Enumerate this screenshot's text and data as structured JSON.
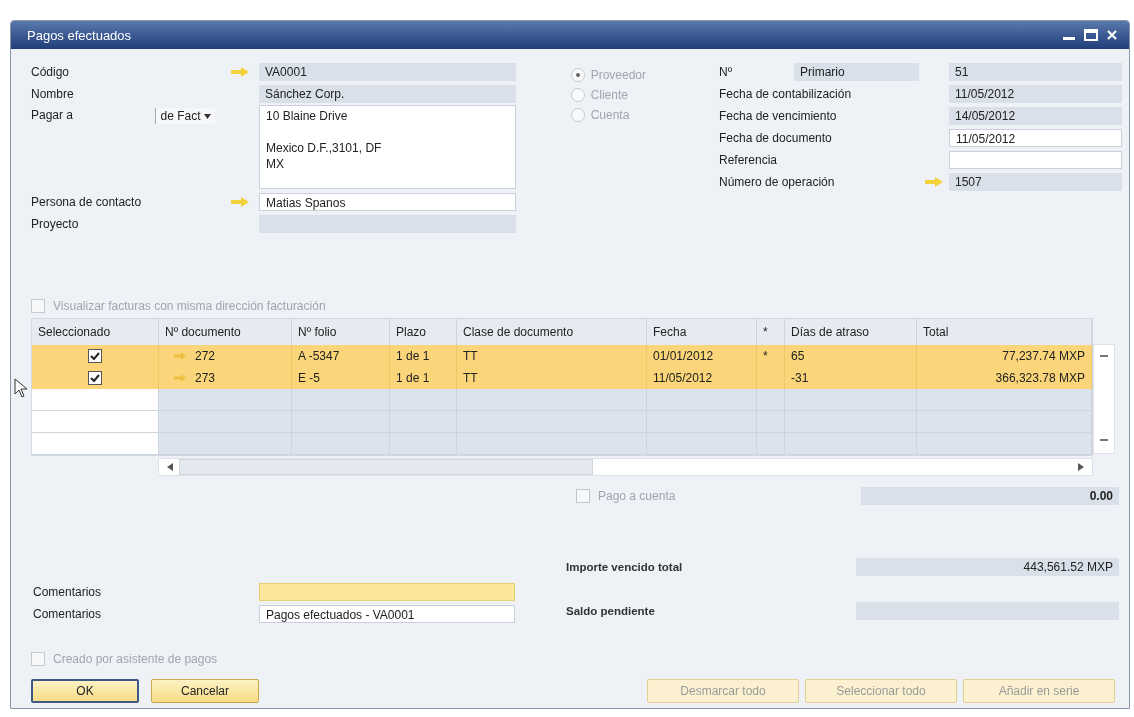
{
  "window": {
    "title": "Pagos efectuados"
  },
  "left_form": [
    {
      "kind": "arrow",
      "label": "Código",
      "value": "VA0001",
      "editable": false
    },
    {
      "kind": "plain",
      "label": "Nombre",
      "value": "Sánchez Corp.",
      "editable": false
    },
    {
      "kind": "address",
      "label": "Pagar a",
      "dropdown": "de Fact",
      "value": "10 Blaine Drive\n\nMexico D.F.,3101, DF\nMX",
      "editable": true
    },
    {
      "kind": "arrow",
      "label": "Persona de contacto",
      "value": "Matias Spanos",
      "editable": true
    },
    {
      "kind": "plain",
      "label": "Proyecto",
      "editable": false
    }
  ],
  "partner_type": [
    {
      "label": "Proveedor",
      "selected": true,
      "disabled": true
    },
    {
      "label": "Cliente",
      "selected": false,
      "disabled": true
    },
    {
      "label": "Cuenta",
      "selected": false,
      "disabled": true
    }
  ],
  "right_form": [
    {
      "kind": "series",
      "label": "Nº",
      "series": "Primario",
      "value": "51",
      "editable": false
    },
    {
      "kind": "plain",
      "label": "Fecha de contabilización",
      "value": "11/05/2012",
      "editable": false
    },
    {
      "kind": "plain",
      "label": "Fecha de vencimiento",
      "value": "14/05/2012",
      "editable": false
    },
    {
      "kind": "plain",
      "label": "Fecha de documento",
      "value": "11/05/2012",
      "editable": true
    },
    {
      "kind": "plain",
      "label": "Referencia",
      "editable": true
    },
    {
      "kind": "arrow",
      "label": "Número de operación",
      "value": "1507",
      "editable": false
    }
  ],
  "same_address_checkbox": {
    "label": "Visualizar facturas con misma dirección facturación",
    "checked": false,
    "disabled": true
  },
  "table": {
    "columns": [
      "Seleccionado",
      "Nº documento",
      "Nº folio",
      "Plazo",
      "Clase de documento",
      "Fecha",
      "*",
      "Días de atraso",
      "Total"
    ],
    "rows": [
      {
        "checked": true,
        "doc": "272",
        "folio": "A -5347",
        "plazo": "1 de 1",
        "clase": "TT",
        "fecha": "01/01/2012",
        "mark": "*",
        "dias": "65",
        "total": "77,237.74 MXP"
      },
      {
        "checked": true,
        "doc": "273",
        "folio": "E -5",
        "plazo": "1 de 1",
        "clase": "TT",
        "fecha": "11/05/2012",
        "dias": "-31",
        "total": "366,323.78 MXP"
      }
    ]
  },
  "payment_on_account": {
    "label": "Pago a cuenta",
    "checked": false,
    "disabled": true,
    "value": "0.00"
  },
  "totals": [
    {
      "label": "Importe vencido total",
      "value": "443,561.52 MXP"
    },
    {
      "label": "Saldo pendiente"
    }
  ],
  "comments": [
    {
      "label": "Comentarios",
      "focused": true
    },
    {
      "label": "Comentarios",
      "value": "Pagos efectuados - VA0001",
      "focused": false
    }
  ],
  "wizard_checkbox": {
    "label": "Creado por asistente de pagos",
    "checked": false,
    "disabled": true
  },
  "buttons_left": [
    {
      "label": "OK",
      "default": true
    },
    {
      "label": "Cancelar",
      "default": false
    }
  ],
  "buttons_right": [
    {
      "label": "Desmarcar todo",
      "disabled": true
    },
    {
      "label": "Seleccionar todo",
      "disabled": true
    },
    {
      "label": "Añadir en serie",
      "disabled": true
    }
  ]
}
